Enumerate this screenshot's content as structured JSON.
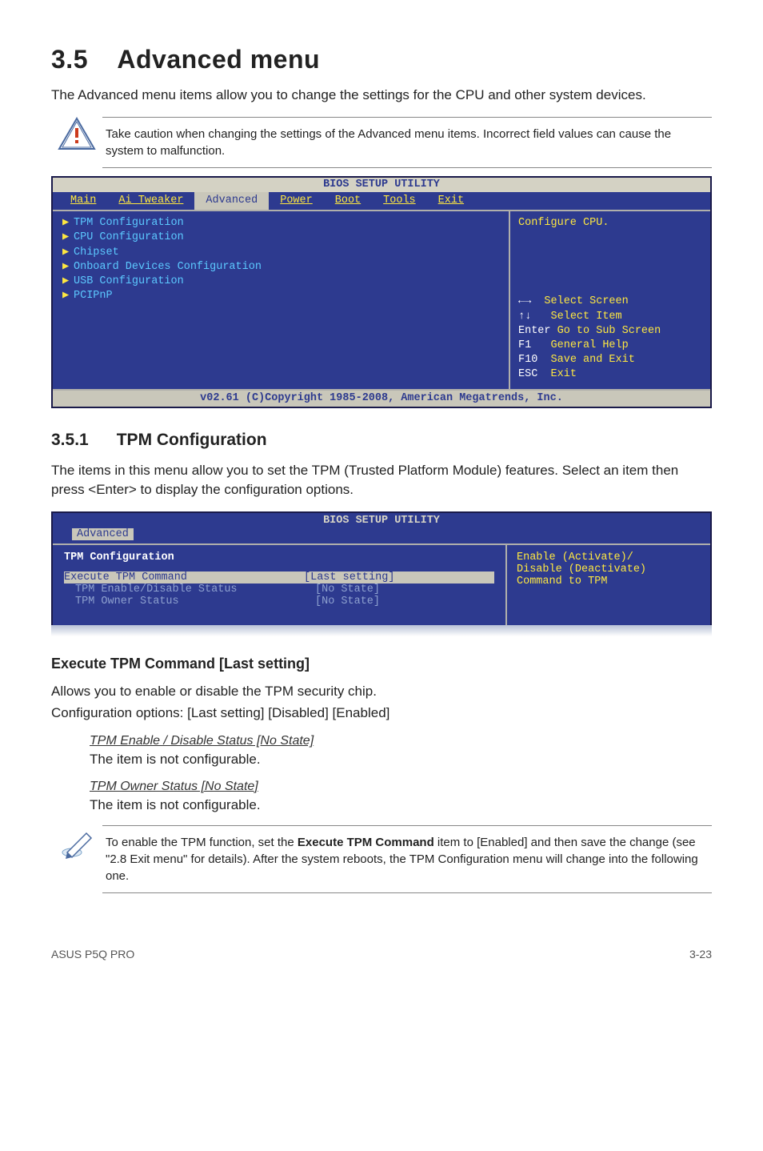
{
  "section_number": "3.5",
  "section_title": "Advanced menu",
  "intro": "The Advanced menu items allow you to change the settings for the CPU and other system devices.",
  "caution_note": "Take caution when changing the settings of the Advanced menu items. Incorrect field values can cause the system to malfunction.",
  "bios1": {
    "title": "BIOS SETUP UTILITY",
    "tabs": [
      "Main",
      "Ai Tweaker",
      "Advanced",
      "Power",
      "Boot",
      "Tools",
      "Exit"
    ],
    "selected_tab": "Advanced",
    "menu_items": [
      "TPM Configuration",
      "CPU Configuration",
      "Chipset",
      "Onboard Devices Configuration",
      "USB Configuration",
      "PCIPnP"
    ],
    "help_top": "Configure CPU.",
    "keyhelp": [
      {
        "k": "←→ ",
        "d": "Select Screen"
      },
      {
        "k": "↑↓  ",
        "d": "Select Item"
      },
      {
        "k": "Enter ",
        "d": "Go to Sub Screen"
      },
      {
        "k": "F1  ",
        "d": "General Help"
      },
      {
        "k": "F10 ",
        "d": "Save and Exit"
      },
      {
        "k": "ESC ",
        "d": "Exit"
      }
    ],
    "footer": "v02.61 (C)Copyright 1985-2008, American Megatrends, Inc."
  },
  "subsection_number": "3.5.1",
  "subsection_title": "TPM Configuration",
  "subsection_intro": "The items in this menu allow you to set the TPM (Trusted Platform Module) features. Select an item then press <Enter> to display the configuration options.",
  "bios2": {
    "title": "BIOS SETUP UTILITY",
    "tab": "Advanced",
    "panel_header": "TPM Configuration",
    "rows": [
      {
        "label": "Execute TPM Command",
        "value": "[Last setting]",
        "selected": true
      },
      {
        "label": "TPM Enable/Disable Status",
        "value": "[No State]",
        "selected": false
      },
      {
        "label": "TPM Owner Status",
        "value": "[No State]",
        "selected": false
      }
    ],
    "help_lines": [
      "Enable (Activate)/",
      "Disable (Deactivate)",
      "Command to TPM"
    ]
  },
  "exec_heading": "Execute TPM Command [Last setting]",
  "exec_p1": "Allows you to enable or disable the TPM security chip.",
  "exec_p2": "Configuration options: [Last setting] [Disabled] [Enabled]",
  "sub_items": [
    {
      "title": "TPM Enable / Disable Status [No State]",
      "desc": "The item is not configurable."
    },
    {
      "title": "TPM Owner Status [No State]",
      "desc": "The item is not configurable."
    }
  ],
  "enable_note_pre": "To enable the TPM function, set the ",
  "enable_note_bold": "Execute TPM Command",
  "enable_note_post": " item to [Enabled] and then save the change (see \"2.8 Exit menu\" for details). After the system reboots, the TPM Configuration menu will change into the following one.",
  "footer_left": "ASUS P5Q PRO",
  "footer_right": "3-23"
}
